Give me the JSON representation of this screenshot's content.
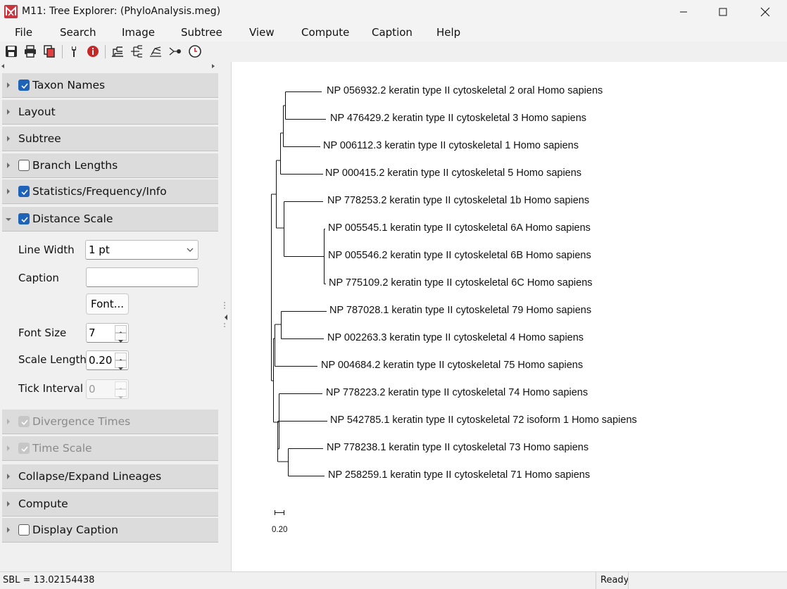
{
  "window": {
    "title": "M11: Tree Explorer: (PhyloAnalysis.meg)"
  },
  "menu": [
    "File",
    "Search",
    "Image",
    "Subtree",
    "View",
    "Compute",
    "Caption",
    "Help"
  ],
  "toolbar_icons": [
    "save-icon",
    "print-icon",
    "copy-icon",
    "options-icon",
    "info-icon",
    "tree-icon",
    "tree-icon",
    "tree-icon",
    "node-icon",
    "clock-icon"
  ],
  "sidebar": {
    "sections": [
      {
        "label": "Taxon Names",
        "checkbox": "checked",
        "expanded": false
      },
      {
        "label": "Layout",
        "checkbox": "none",
        "expanded": false
      },
      {
        "label": "Subtree",
        "checkbox": "none",
        "expanded": false
      },
      {
        "label": "Branch Lengths",
        "checkbox": "unchecked",
        "expanded": false
      },
      {
        "label": "Statistics/Frequency/Info",
        "checkbox": "checked",
        "expanded": false
      },
      {
        "label": "Distance Scale",
        "checkbox": "checked",
        "expanded": true
      },
      {
        "label": "Divergence Times",
        "checkbox": "disabled",
        "expanded": false
      },
      {
        "label": "Time Scale",
        "checkbox": "disabled",
        "expanded": false
      },
      {
        "label": "Collapse/Expand Lineages",
        "checkbox": "none",
        "expanded": false
      },
      {
        "label": "Compute",
        "checkbox": "none",
        "expanded": false
      },
      {
        "label": "Display Caption",
        "checkbox": "unchecked",
        "expanded": false
      }
    ],
    "distance_scale": {
      "line_width_label": "Line Width",
      "line_width_value": "1 pt",
      "caption_label": "Caption",
      "caption_value": "",
      "font_button": "Font...",
      "font_size_label": "Font Size",
      "font_size_value": "7",
      "scale_length_label": "Scale Length",
      "scale_length_value": "0.20",
      "tick_interval_label": "Tick Interval",
      "tick_interval_value": "0"
    }
  },
  "tree": {
    "taxa": [
      "NP 056932.2 keratin type II cytoskeletal 2 oral Homo sapiens",
      "NP 476429.2 keratin type II cytoskeletal 3 Homo sapiens",
      "NP 006112.3 keratin type II cytoskeletal 1 Homo sapiens",
      "NP 000415.2 keratin type II cytoskeletal 5 Homo sapiens",
      "NP 778253.2 keratin type II cytoskeletal 1b Homo sapiens",
      "NP 005545.1 keratin type II cytoskeletal 6A Homo sapiens",
      "NP 005546.2 keratin type II cytoskeletal 6B Homo sapiens",
      "NP 775109.2 keratin type II cytoskeletal 6C Homo sapiens",
      "NP 787028.1 keratin type II cytoskeletal 79 Homo sapiens",
      "NP 002263.3 keratin type II cytoskeletal 4 Homo sapiens",
      "NP 004684.2 keratin type II cytoskeletal 75 Homo sapiens",
      "NP 778223.2 keratin type II cytoskeletal 74 Homo sapiens",
      "NP 542785.1 keratin type II cytoskeletal 72 isoform 1 Homo sapiens",
      "NP 778238.1 keratin type II cytoskeletal 73 Homo sapiens",
      "NP 258259.1 keratin type II cytoskeletal 71 Homo sapiens"
    ],
    "scale_label": "0.20"
  },
  "status": {
    "sbl": "SBL = 13.02154438",
    "state": "Ready"
  },
  "colors": {
    "accent": "#1e63b8",
    "app_icon": "#c9343d",
    "panel_header": "#dcdcdc"
  }
}
